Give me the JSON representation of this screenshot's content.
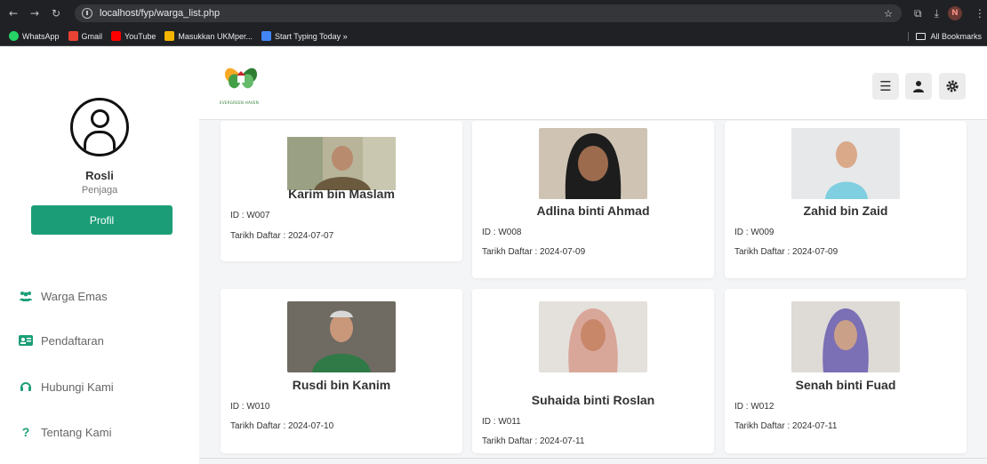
{
  "browser": {
    "url": "localhost/fyp/warga_list.php",
    "bookmarks": [
      "WhatsApp",
      "Gmail",
      "YouTube",
      "Masukkan UKMper...",
      "Start Typing Today »"
    ],
    "all_bookmarks": "All Bookmarks",
    "profile_initial": "N"
  },
  "sidebar": {
    "user_name": "Rosli",
    "user_role": "Penjaga",
    "profile_button": "Profil",
    "items": [
      {
        "label": "Warga Emas",
        "icon": "users-icon"
      },
      {
        "label": "Pendaftaran",
        "icon": "id-card-icon"
      },
      {
        "label": "Hubungi Kami",
        "icon": "headset-icon"
      },
      {
        "label": "Tentang Kami",
        "icon": "question-icon"
      }
    ]
  },
  "topbar": {
    "logo_text": "EVERGREEN HAVEN",
    "buttons": [
      "menu-icon",
      "user-icon",
      "settings-icon"
    ]
  },
  "cards": [
    {
      "name": "Karim bin Maslam",
      "id": "ID : W007",
      "date": "Tarikh Daftar : 2024-07-07"
    },
    {
      "name": "Adlina binti Ahmad",
      "id": "ID : W008",
      "date": "Tarikh Daftar : 2024-07-09"
    },
    {
      "name": "Zahid bin Zaid",
      "id": "ID : W009",
      "date": "Tarikh Daftar : 2024-07-09"
    },
    {
      "name": "Rusdi bin Kanim",
      "id": "ID : W010",
      "date": "Tarikh Daftar : 2024-07-10"
    },
    {
      "name": "Suhaida binti Roslan",
      "id": "ID : W011",
      "date": "Tarikh Daftar : 2024-07-11"
    },
    {
      "name": "Senah binti Fuad",
      "id": "ID : W012",
      "date": "Tarikh Daftar : 2024-07-11"
    }
  ],
  "colors": {
    "accent": "#1b9e77"
  }
}
